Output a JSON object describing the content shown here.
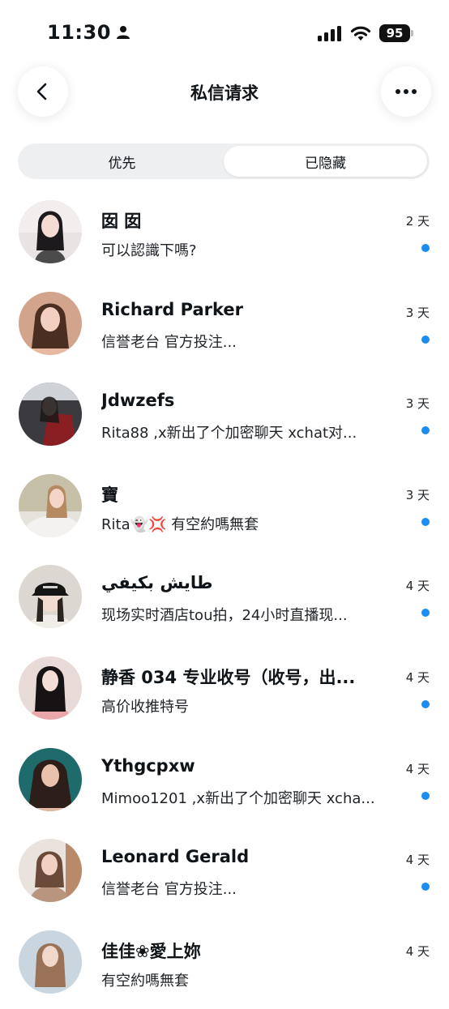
{
  "status_bar": {
    "time": "11:30",
    "battery": "95"
  },
  "header": {
    "title": "私信请求"
  },
  "tabs": [
    {
      "label": "优先",
      "active": false
    },
    {
      "label": "已隐藏",
      "active": true
    }
  ],
  "conversations": [
    {
      "name": "囡 囡",
      "preview": "可以認識下嗎?",
      "time": "2 天",
      "unread": true
    },
    {
      "name": "Richard Parker",
      "preview": "信誉老台 官方投注...",
      "time": "3 天",
      "unread": true
    },
    {
      "name": "Jdwzefs",
      "preview": "Rita88 ,x新出了个加密聊天 xchat对...",
      "time": "3 天",
      "unread": true
    },
    {
      "name": "寶",
      "preview": "Rita👻💢 有空約嗎無套",
      "time": "3 天",
      "unread": true
    },
    {
      "name": "طايش بكيفي",
      "preview": "现场实时酒店tou拍，24小时直播现...",
      "time": "4 天",
      "unread": true
    },
    {
      "name": "静香 034 专业收号（收号，出...",
      "preview": "高价收推特号",
      "time": "4 天",
      "unread": true
    },
    {
      "name": "Ythgcpxw",
      "preview": "Mimoo1201 ,x新出了个加密聊天 xcha...",
      "time": "4 天",
      "unread": true
    },
    {
      "name": "Leonard Gerald",
      "preview": "信誉老台 官方投注...",
      "time": "4 天",
      "unread": true
    },
    {
      "name": "佳佳❀愛上妳",
      "preview": "有空約嗎無套",
      "time": "4 天",
      "unread": false
    }
  ]
}
